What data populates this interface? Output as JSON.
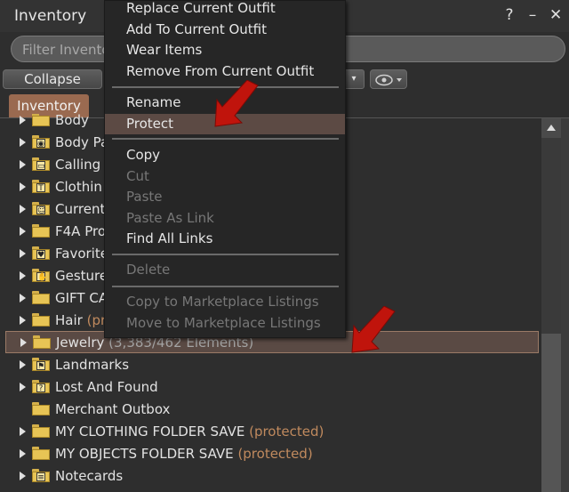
{
  "window": {
    "title": "Inventory",
    "help_icon": "?",
    "minimize_icon": "–",
    "close_icon": "✕"
  },
  "filter": {
    "placeholder": "Filter Invento"
  },
  "toolbar": {
    "collapse_label": "Collapse",
    "dropdown_glyph": "▾"
  },
  "tab": {
    "label": "Inventory"
  },
  "list": {
    "rows": [
      {
        "label": "Body",
        "suffix": "",
        "icon": "folder-icon"
      },
      {
        "label": "Body Pa",
        "suffix": "",
        "icon": "bodypart-folder-icon"
      },
      {
        "label": "Calling",
        "suffix": "",
        "icon": "callingcard-folder-icon"
      },
      {
        "label": "Clothin",
        "suffix": "",
        "icon": "clothing-folder-icon"
      },
      {
        "label": "Current",
        "suffix": "",
        "icon": "current-outfit-folder-icon"
      },
      {
        "label": "F4A Pro",
        "suffix": "",
        "icon": "folder-icon"
      },
      {
        "label": "Favorite",
        "suffix": "",
        "icon": "favorites-folder-icon"
      },
      {
        "label": "Gesture",
        "suffix": "",
        "icon": "gesture-folder-icon"
      },
      {
        "label": "GIFT CA",
        "suffix": "",
        "icon": "folder-icon"
      },
      {
        "label": "Hair",
        "suffix": "(pr",
        "icon": "folder-icon"
      },
      {
        "label": "Jewelry",
        "suffix": "(3,383/462 Elements)",
        "icon": "folder-icon"
      },
      {
        "label": "Landmarks",
        "suffix": "",
        "icon": "landmarks-folder-icon"
      },
      {
        "label": "Lost And Found",
        "suffix": "",
        "icon": "lost-and-found-folder-icon"
      },
      {
        "label": "Merchant Outbox",
        "suffix": "",
        "icon": "folder-icon"
      },
      {
        "label": "MY CLOTHING FOLDER SAVE",
        "suffix": "(protected)",
        "icon": "folder-icon"
      },
      {
        "label": "MY OBJECTS FOLDER SAVE",
        "suffix": "(protected)",
        "icon": "folder-icon"
      },
      {
        "label": "Notecards",
        "suffix": "",
        "icon": "notecards-folder-icon"
      }
    ]
  },
  "menu": {
    "group1": [
      "Replace Current Outfit",
      "Add To Current Outfit",
      "Wear Items",
      "Remove From Current Outfit"
    ],
    "group2": [
      "Rename",
      "Protect"
    ],
    "group3": [
      "Copy",
      "Cut",
      "Paste",
      "Paste As Link",
      "Find All Links"
    ],
    "group4": [
      "Delete"
    ],
    "group5": [
      "Copy to Marketplace Listings",
      "Move to Marketplace Listings"
    ]
  },
  "colors": {
    "highlight": "#5c4a44",
    "tab": "#9a6a50",
    "protected_text": "#c08a5e",
    "annotation_arrow": "#c0140c",
    "folder": "#e7c455"
  }
}
